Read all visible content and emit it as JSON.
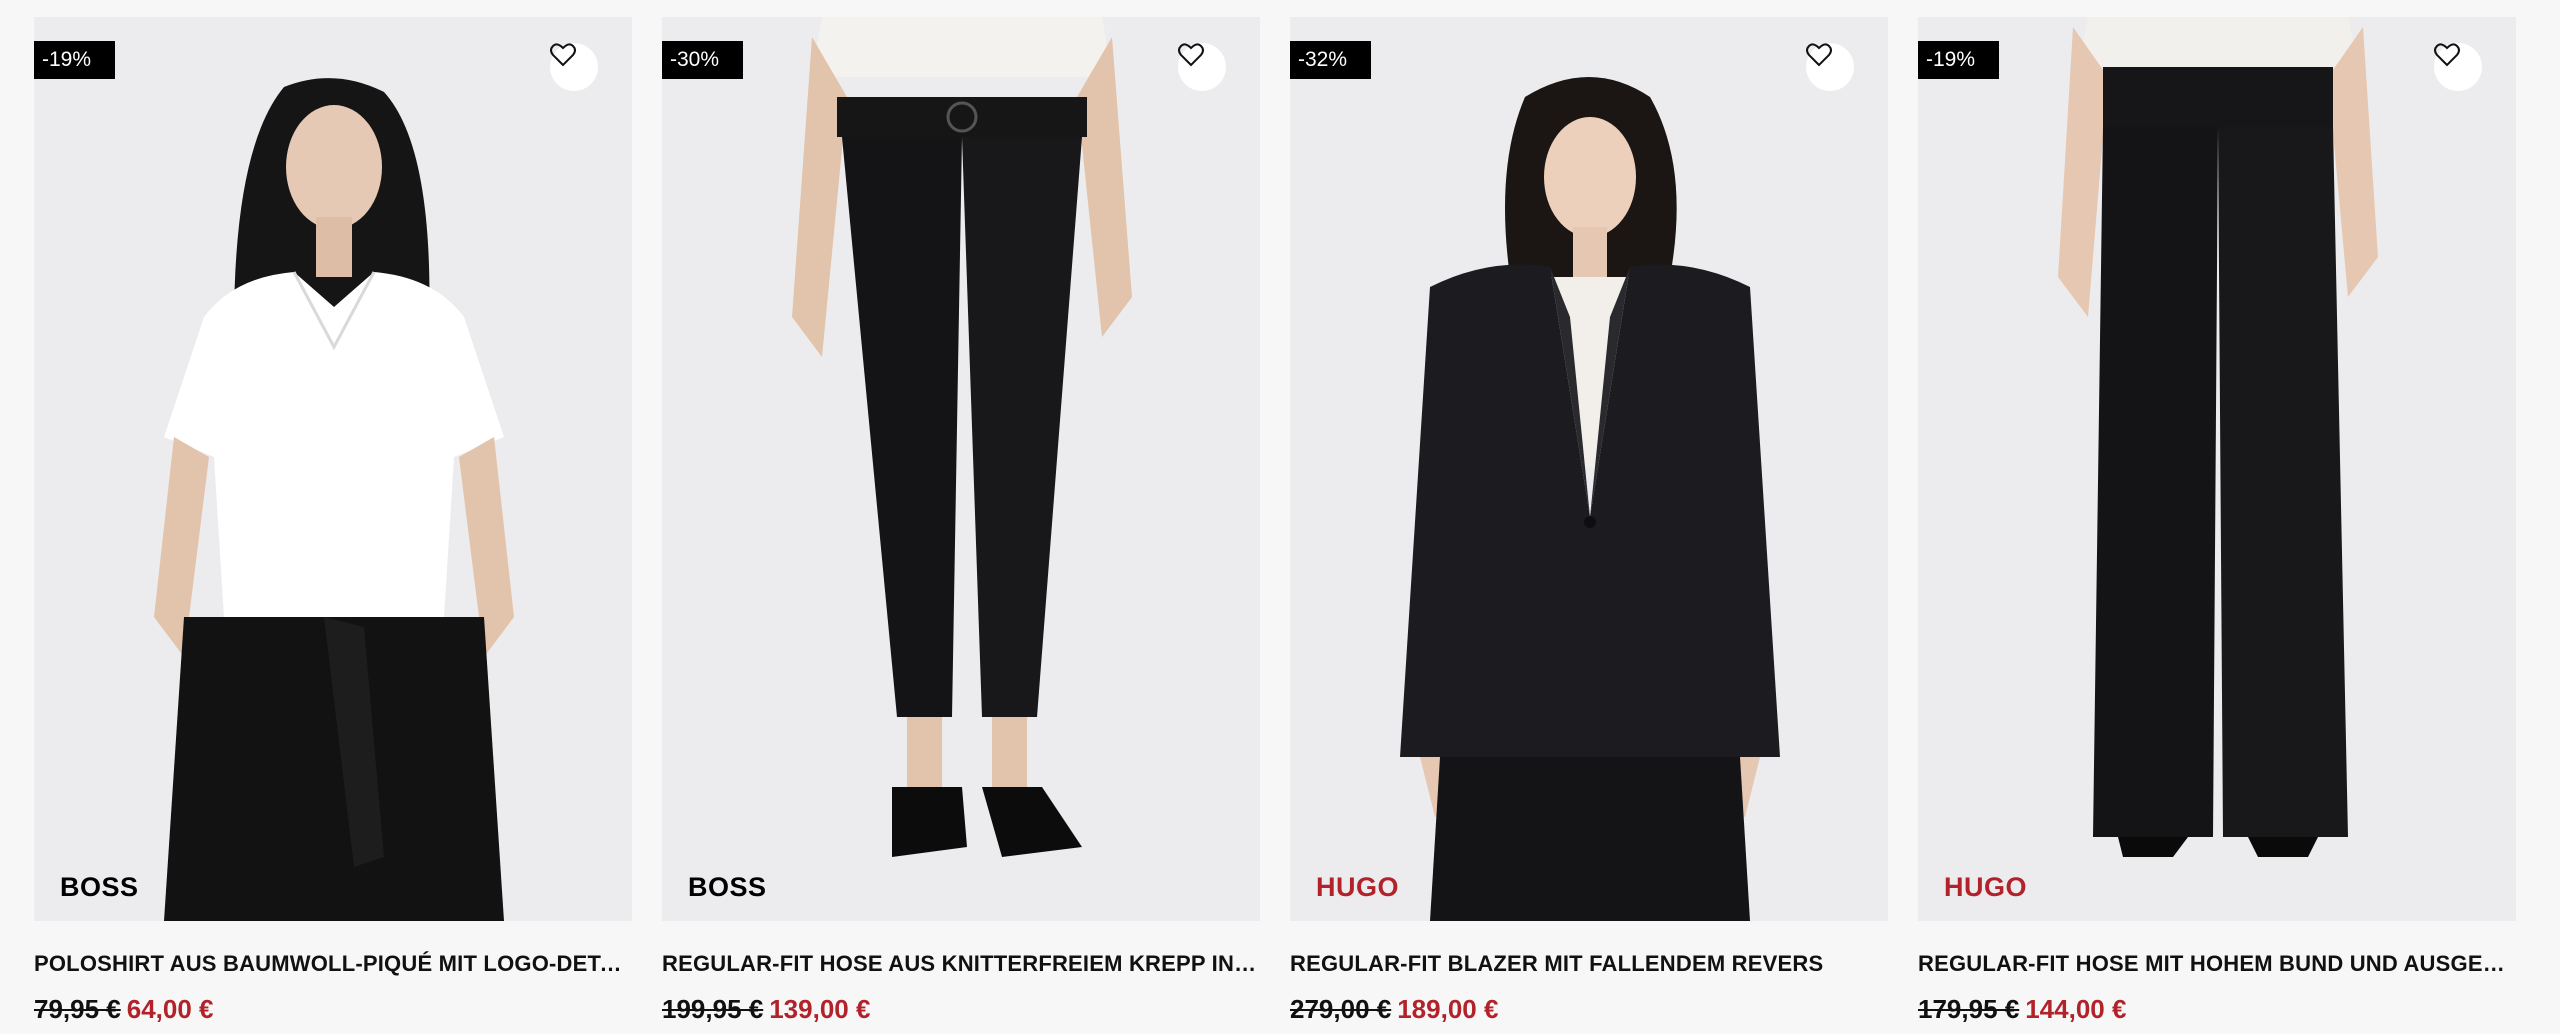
{
  "products": [
    {
      "badge": "-19%",
      "brand": "BOSS",
      "brand_color": "#000000",
      "title": "POLOSHIRT AUS BAUMWOLL-PIQUÉ MIT LOGO-DETAIL",
      "old_price": "79,95 €",
      "new_price": "64,00 €"
    },
    {
      "badge": "-30%",
      "brand": "BOSS",
      "brand_color": "#000000",
      "title": "REGULAR-FIT HOSE AUS KNITTERFREIEM KREPP IN CR...",
      "old_price": "199,95 €",
      "new_price": "139,00 €"
    },
    {
      "badge": "-32%",
      "brand": "HUGO",
      "brand_color": "#b2222a",
      "title": "REGULAR-FIT BLAZER MIT FALLENDEM REVERS",
      "old_price": "279,00 €",
      "new_price": "189,00 €"
    },
    {
      "badge": "-19%",
      "brand": "HUGO",
      "brand_color": "#b2222a",
      "title": "REGULAR-FIT HOSE MIT HOHEM BUND UND AUSGESTE...",
      "old_price": "179,95 €",
      "new_price": "144,00 €"
    }
  ],
  "icons": {
    "wishlist": "heart-outline-icon"
  },
  "colors": {
    "sale_price": "#b2222a",
    "badge_bg": "#000000",
    "image_bg": "#ececee"
  }
}
